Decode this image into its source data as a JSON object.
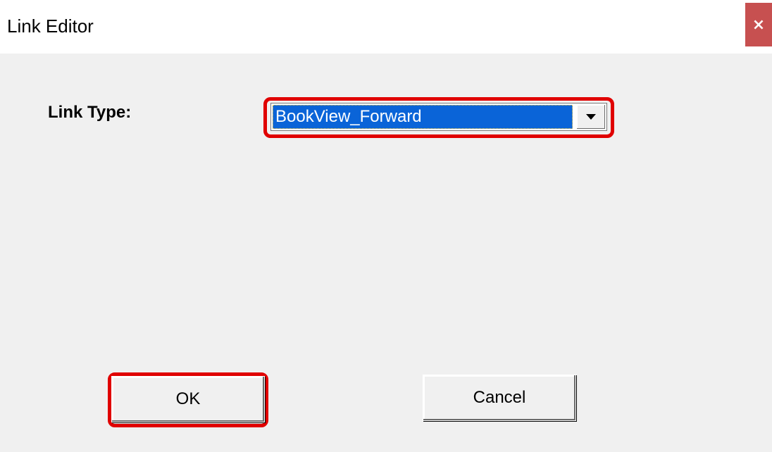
{
  "window": {
    "title": "Link Editor",
    "close_glyph": "×"
  },
  "form": {
    "link_type_label": "Link Type:",
    "link_type_value": "BookView_Forward"
  },
  "buttons": {
    "ok_label": "OK",
    "cancel_label": "Cancel"
  },
  "colors": {
    "close_button": "#c75050",
    "selection": "#0a64d8",
    "highlight": "#e00000",
    "dialog_bg": "#f0f0f0"
  },
  "icons": {
    "close": "close-icon",
    "dropdown": "chevron-down-icon"
  }
}
